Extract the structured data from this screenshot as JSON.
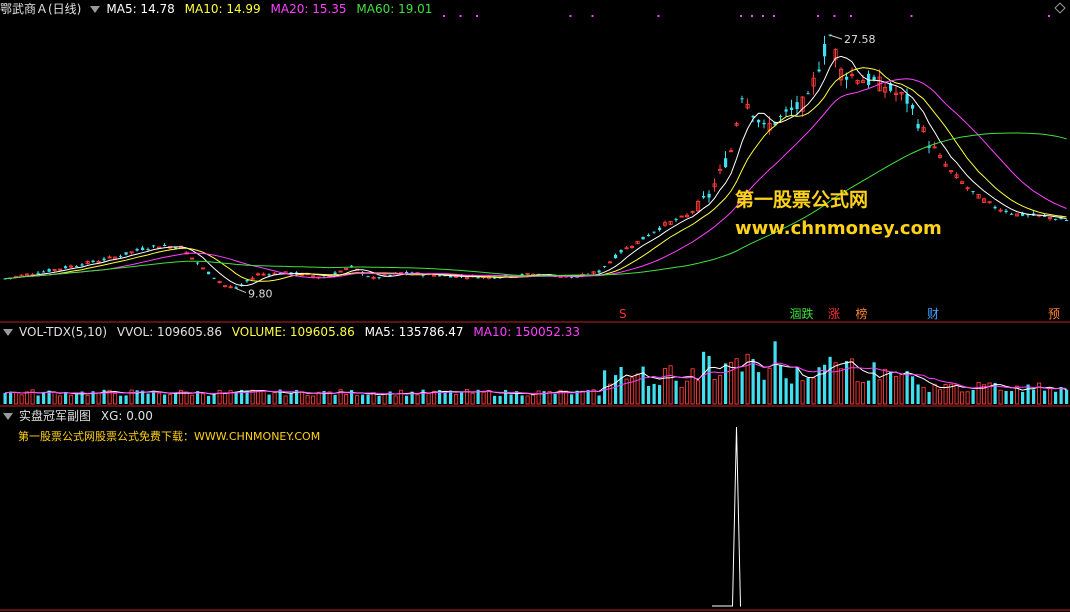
{
  "price_panel": {
    "stock_name": "鄂武商Ａ(日线)",
    "ma5": "MA5: 14.78",
    "ma10": "MA10: 14.99",
    "ma20": "MA20: 15.35",
    "ma60": "MA60: 19.01",
    "high_label": "27.58",
    "low_label": "9.80",
    "watermark_title": "第一股票公式网",
    "watermark_url": "www.chnmoney.com",
    "markers": [
      {
        "text": "S",
        "color": "#ff3030",
        "bar": 112
      },
      {
        "text": "涸跌",
        "color": "#40e040",
        "bar": 143
      },
      {
        "text": "涨",
        "color": "#ff3030",
        "bar": 150
      },
      {
        "text": "榜",
        "color": "#ff8030",
        "bar": 155
      },
      {
        "text": "财",
        "color": "#40a0ff",
        "bar": 168
      },
      {
        "text": "预",
        "color": "#ff8030",
        "bar": 190
      }
    ],
    "colors": {
      "ma5": "#ffffff",
      "ma10": "#ffff40",
      "ma20": "#ff40ff",
      "ma60": "#40e040",
      "up": "#ff3a3a",
      "down": "#40e0f0"
    }
  },
  "volume_panel": {
    "title": "VOL-TDX(5,10)",
    "vvol": "VVOL: 109605.86",
    "volume": "VOLUME: 109605.86",
    "ma5": "MA5: 135786.47",
    "ma10": "MA10: 150052.33"
  },
  "indicator_panel": {
    "title": "实盘冠军副图",
    "xg": "XG: 0.00",
    "note": "第一股票公式网股票公式免费下载：WWW.CHNMONEY.COM"
  },
  "chart_data": {
    "type": "candlestick",
    "xlabel": "",
    "ylabel": "",
    "ylim": [
      9.0,
      28.5
    ],
    "price_points": [
      [
        0,
        10.5
      ],
      [
        10,
        11.2
      ],
      [
        20,
        12.0
      ],
      [
        25,
        12.6
      ],
      [
        28,
        12.8
      ],
      [
        32,
        12.7
      ],
      [
        36,
        11.2
      ],
      [
        40,
        10.0
      ],
      [
        42,
        9.8
      ],
      [
        46,
        10.8
      ],
      [
        52,
        10.9
      ],
      [
        58,
        10.6
      ],
      [
        63,
        11.3
      ],
      [
        67,
        10.5
      ],
      [
        72,
        10.9
      ],
      [
        80,
        10.7
      ],
      [
        88,
        10.6
      ],
      [
        96,
        10.8
      ],
      [
        104,
        10.6
      ],
      [
        108,
        11.0
      ],
      [
        112,
        12.4
      ],
      [
        116,
        13.3
      ],
      [
        120,
        14.3
      ],
      [
        124,
        14.9
      ],
      [
        128,
        16.3
      ],
      [
        132,
        19.5
      ],
      [
        134,
        23.5
      ],
      [
        138,
        21.0
      ],
      [
        142,
        22.0
      ],
      [
        146,
        23.0
      ],
      [
        148,
        25.5
      ],
      [
        150,
        27.58
      ],
      [
        152,
        25.0
      ],
      [
        156,
        24.5
      ],
      [
        160,
        24.0
      ],
      [
        164,
        23.0
      ],
      [
        168,
        20.0
      ],
      [
        172,
        18.0
      ],
      [
        176,
        16.5
      ],
      [
        180,
        15.5
      ],
      [
        184,
        15.0
      ],
      [
        188,
        14.9
      ],
      [
        193,
        14.6
      ]
    ],
    "peak": 27.58,
    "trough": 9.8
  }
}
